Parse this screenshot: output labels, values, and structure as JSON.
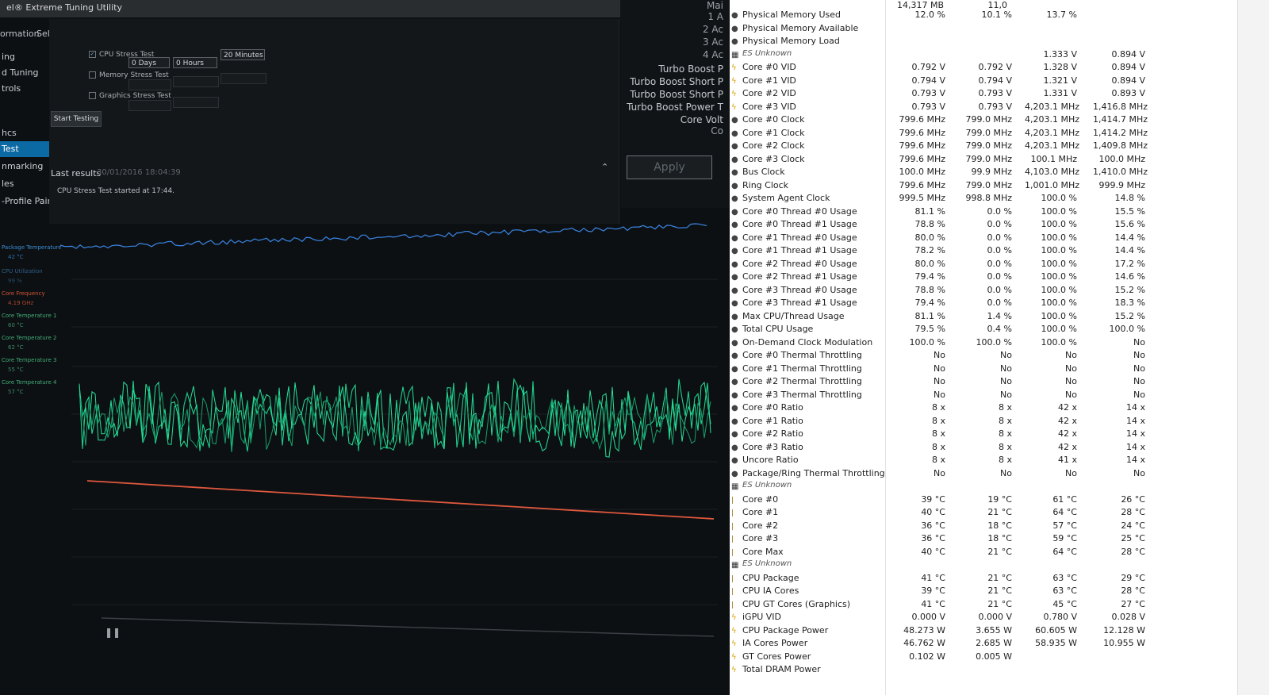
{
  "xtu": {
    "title": "el® Extreme Tuning Utility",
    "tabs": [
      "ormation",
      "Select Stress Test"
    ],
    "sidebar": [
      "ing",
      "d Tuning",
      "trols",
      "",
      "hcs",
      "Test",
      "nmarking",
      "les",
      "-Profile Pairing"
    ],
    "active_sidebar_index": 5,
    "stress_tests": [
      {
        "label": "CPU Stress Test",
        "checked": true
      },
      {
        "label": "Memory Stress Test",
        "checked": false
      },
      {
        "label": "Graphics Stress Test",
        "checked": false
      }
    ],
    "duration": {
      "days": "0 Days",
      "hours": "0 Hours",
      "minutes": "20 Minutes"
    },
    "start_button": "Start Testing",
    "last_results_label": "Last results",
    "last_results_date": "30/01/2016 18:04:39",
    "started_message": "CPU Stress Test started at 17:44.",
    "tuning": {
      "numbers": [
        "1 A",
        "2 Ac",
        "3 Ac",
        "4 Ac"
      ],
      "labels": [
        "Turbo Boost P",
        "Turbo Boost Short P",
        "Turbo Boost Short P",
        "Turbo Boost Power T",
        "Core Volt"
      ],
      "apply_button": "Apply",
      "top_char": "C",
      "co_char": "Co",
      "mai_char": "Mai"
    },
    "monitor_legend": [
      {
        "label": "Package Temperature",
        "value": "42 °C"
      },
      {
        "label": "CPU Utilization",
        "value": "99 %"
      },
      {
        "label": "Core Frequency",
        "value": "4.19 GHz"
      },
      {
        "label": "Core Temperature 1",
        "value": "60 °C"
      },
      {
        "label": "Core Temperature 2",
        "value": "62 °C"
      },
      {
        "label": "Core Temperature 3",
        "value": "55 °C"
      },
      {
        "label": "Core Temperature 4",
        "value": "57 °C"
      }
    ],
    "pause_icon": "pause-icon"
  },
  "hwinfo": {
    "top_header": [
      "14,317 MB",
      "11,0",
      "",
      ""
    ],
    "rows": [
      {
        "icon": "dot",
        "label": "Physical Memory Used",
        "v": [
          "12.0 %",
          "10.1 %",
          "13.7 %",
          ""
        ]
      },
      {
        "icon": "dot",
        "label": "Physical Memory Available",
        "v": [
          "",
          "",
          "",
          ""
        ]
      },
      {
        "icon": "dot",
        "label": "Physical Memory Load",
        "v": [
          "",
          "",
          "",
          ""
        ]
      },
      {
        "icon": "cpu",
        "label": "ES Unknown",
        "v": [
          "",
          "",
          "1.333 V",
          "0.894 V"
        ],
        "group": true
      },
      {
        "icon": "volt",
        "label": "Core #0 VID",
        "v": [
          "0.792 V",
          "0.792 V",
          "1.328 V",
          "0.894 V"
        ]
      },
      {
        "icon": "volt",
        "label": "Core #1 VID",
        "v": [
          "0.794 V",
          "0.794 V",
          "1.321 V",
          "0.894 V"
        ]
      },
      {
        "icon": "volt",
        "label": "Core #2 VID",
        "v": [
          "0.793 V",
          "0.793 V",
          "1.331 V",
          "0.893 V"
        ]
      },
      {
        "icon": "volt",
        "label": "Core #3 VID",
        "v": [
          "0.793 V",
          "0.793 V",
          "4,203.1 MHz",
          "1,416.8 MHz"
        ]
      },
      {
        "icon": "dot",
        "label": "Core #0 Clock",
        "v": [
          "799.6 MHz",
          "799.0 MHz",
          "4,203.1 MHz",
          "1,414.7 MHz"
        ]
      },
      {
        "icon": "dot",
        "label": "Core #1 Clock",
        "v": [
          "799.6 MHz",
          "799.0 MHz",
          "4,203.1 MHz",
          "1,414.2 MHz"
        ]
      },
      {
        "icon": "dot",
        "label": "Core #2 Clock",
        "v": [
          "799.6 MHz",
          "799.0 MHz",
          "4,203.1 MHz",
          "1,409.8 MHz"
        ]
      },
      {
        "icon": "dot",
        "label": "Core #3 Clock",
        "v": [
          "799.6 MHz",
          "799.0 MHz",
          "100.1 MHz",
          "100.0 MHz"
        ]
      },
      {
        "icon": "dot",
        "label": "Bus Clock",
        "v": [
          "100.0 MHz",
          "99.9 MHz",
          "4,103.0 MHz",
          "1,410.0 MHz"
        ]
      },
      {
        "icon": "dot",
        "label": "Ring Clock",
        "v": [
          "799.6 MHz",
          "799.0 MHz",
          "1,001.0 MHz",
          "999.9 MHz"
        ]
      },
      {
        "icon": "dot",
        "label": "System Agent Clock",
        "v": [
          "999.5 MHz",
          "998.8 MHz",
          "100.0 %",
          "14.8 %"
        ]
      },
      {
        "icon": "dot",
        "label": "Core #0 Thread #0 Usage",
        "v": [
          "81.1 %",
          "0.0 %",
          "100.0 %",
          "15.5 %"
        ]
      },
      {
        "icon": "dot",
        "label": "Core #0 Thread #1 Usage",
        "v": [
          "78.8 %",
          "0.0 %",
          "100.0 %",
          "15.6 %"
        ]
      },
      {
        "icon": "dot",
        "label": "Core #1 Thread #0 Usage",
        "v": [
          "80.0 %",
          "0.0 %",
          "100.0 %",
          "14.4 %"
        ]
      },
      {
        "icon": "dot",
        "label": "Core #1 Thread #1 Usage",
        "v": [
          "78.2 %",
          "0.0 %",
          "100.0 %",
          "14.4 %"
        ]
      },
      {
        "icon": "dot",
        "label": "Core #2 Thread #0 Usage",
        "v": [
          "80.0 %",
          "0.0 %",
          "100.0 %",
          "17.2 %"
        ]
      },
      {
        "icon": "dot",
        "label": "Core #2 Thread #1 Usage",
        "v": [
          "79.4 %",
          "0.0 %",
          "100.0 %",
          "14.6 %"
        ]
      },
      {
        "icon": "dot",
        "label": "Core #3 Thread #0 Usage",
        "v": [
          "78.8 %",
          "0.0 %",
          "100.0 %",
          "15.2 %"
        ]
      },
      {
        "icon": "dot",
        "label": "Core #3 Thread #1 Usage",
        "v": [
          "79.4 %",
          "0.0 %",
          "100.0 %",
          "18.3 %"
        ]
      },
      {
        "icon": "dot",
        "label": "Max CPU/Thread Usage",
        "v": [
          "81.1 %",
          "1.4 %",
          "100.0 %",
          "15.2 %"
        ]
      },
      {
        "icon": "dot",
        "label": "Total CPU Usage",
        "v": [
          "79.5 %",
          "0.4 %",
          "100.0 %",
          "100.0 %"
        ]
      },
      {
        "icon": "dot",
        "label": "On-Demand Clock Modulation",
        "v": [
          "100.0 %",
          "100.0 %",
          "100.0 %",
          "No"
        ]
      },
      {
        "icon": "dot",
        "label": "Core #0 Thermal Throttling",
        "v": [
          "No",
          "No",
          "No",
          "No"
        ]
      },
      {
        "icon": "dot",
        "label": "Core #1 Thermal Throttling",
        "v": [
          "No",
          "No",
          "No",
          "No"
        ]
      },
      {
        "icon": "dot",
        "label": "Core #2 Thermal Throttling",
        "v": [
          "No",
          "No",
          "No",
          "No"
        ]
      },
      {
        "icon": "dot",
        "label": "Core #3 Thermal Throttling",
        "v": [
          "No",
          "No",
          "No",
          "No"
        ]
      },
      {
        "icon": "dot",
        "label": "Core #0 Ratio",
        "v": [
          "8 x",
          "8 x",
          "42 x",
          "14 x"
        ]
      },
      {
        "icon": "dot",
        "label": "Core #1 Ratio",
        "v": [
          "8 x",
          "8 x",
          "42 x",
          "14 x"
        ]
      },
      {
        "icon": "dot",
        "label": "Core #2 Ratio",
        "v": [
          "8 x",
          "8 x",
          "42 x",
          "14 x"
        ]
      },
      {
        "icon": "dot",
        "label": "Core #3 Ratio",
        "v": [
          "8 x",
          "8 x",
          "42 x",
          "14 x"
        ]
      },
      {
        "icon": "dot",
        "label": "Uncore Ratio",
        "v": [
          "8 x",
          "8 x",
          "41 x",
          "14 x"
        ]
      },
      {
        "icon": "dot",
        "label": "Package/Ring Thermal Throttling",
        "v": [
          "No",
          "No",
          "No",
          "No"
        ]
      },
      {
        "icon": "cpu",
        "label": "ES Unknown",
        "v": [
          "",
          "",
          "",
          ""
        ],
        "group": true
      },
      {
        "icon": "temp",
        "label": "Core #0",
        "v": [
          "39 °C",
          "19 °C",
          "61 °C",
          "26 °C"
        ]
      },
      {
        "icon": "temp",
        "label": "Core #1",
        "v": [
          "40 °C",
          "21 °C",
          "64 °C",
          "28 °C"
        ]
      },
      {
        "icon": "temp",
        "label": "Core #2",
        "v": [
          "36 °C",
          "18 °C",
          "57 °C",
          "24 °C"
        ]
      },
      {
        "icon": "temp",
        "label": "Core #3",
        "v": [
          "36 °C",
          "18 °C",
          "59 °C",
          "25 °C"
        ]
      },
      {
        "icon": "temp",
        "label": "Core Max",
        "v": [
          "40 °C",
          "21 °C",
          "64 °C",
          "28 °C"
        ]
      },
      {
        "icon": "cpu",
        "label": "ES Unknown",
        "v": [
          "",
          "",
          "",
          ""
        ],
        "group": true
      },
      {
        "icon": "temp",
        "label": "CPU Package",
        "v": [
          "41 °C",
          "21 °C",
          "63 °C",
          "29 °C"
        ]
      },
      {
        "icon": "temp",
        "label": "CPU IA Cores",
        "v": [
          "39 °C",
          "21 °C",
          "63 °C",
          "28 °C"
        ]
      },
      {
        "icon": "temp",
        "label": "CPU GT Cores (Graphics)",
        "v": [
          "41 °C",
          "21 °C",
          "45 °C",
          "27 °C"
        ]
      },
      {
        "icon": "volt",
        "label": "iGPU VID",
        "v": [
          "0.000 V",
          "0.000 V",
          "0.780 V",
          "0.028 V"
        ]
      },
      {
        "icon": "volt",
        "label": "CPU Package Power",
        "v": [
          "48.273 W",
          "3.655 W",
          "60.605 W",
          "12.128 W"
        ]
      },
      {
        "icon": "volt",
        "label": "IA Cores Power",
        "v": [
          "46.762 W",
          "2.685 W",
          "58.935 W",
          "10.955 W"
        ]
      },
      {
        "icon": "volt",
        "label": "GT Cores Power",
        "v": [
          "0.102 W",
          "0.005 W",
          "",
          ""
        ]
      },
      {
        "icon": "volt",
        "label": "Total DRAM Power",
        "v": [
          "",
          "",
          "",
          ""
        ]
      }
    ]
  }
}
